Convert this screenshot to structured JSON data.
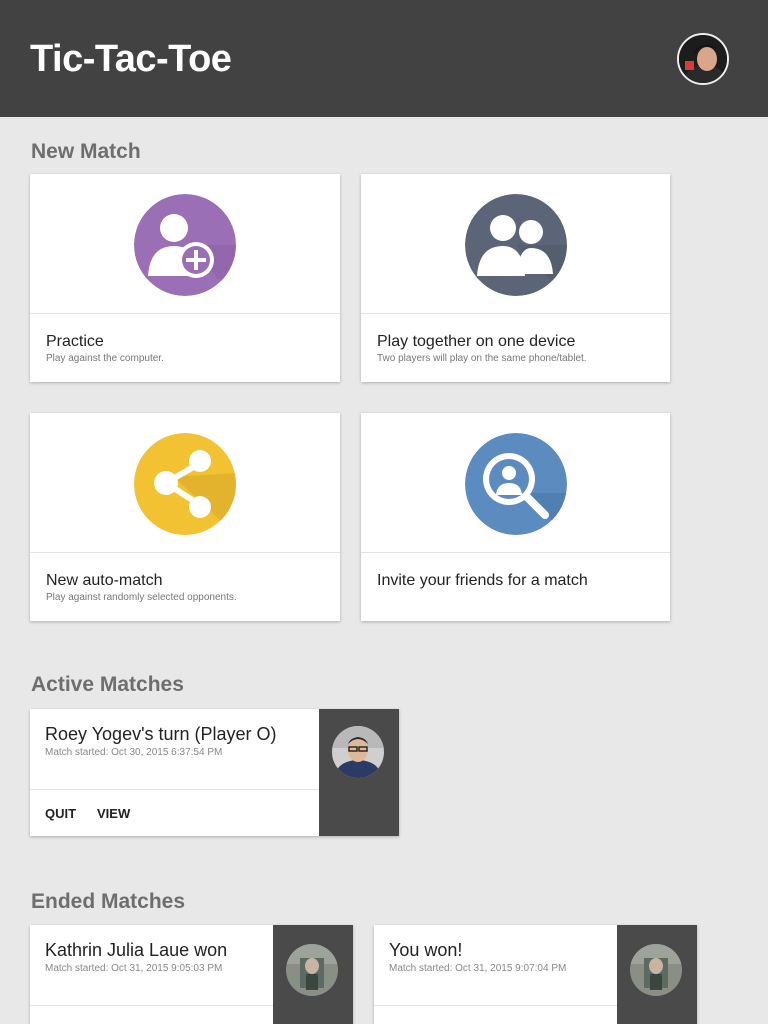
{
  "app": {
    "title": "Tic-Tac-Toe",
    "user_avatar_icon": "user-avatar-photo"
  },
  "sections": {
    "new_match": "New Match",
    "active_matches": "Active Matches",
    "ended_matches": "Ended Matches"
  },
  "new_match_options": [
    {
      "title": "Practice",
      "subtitle": "Play against the computer.",
      "icon": "add-user-icon",
      "color": "#9b6fb5"
    },
    {
      "title": "Play together on one device",
      "subtitle": "Two players will play on the same phone/tablet.",
      "icon": "two-users-icon",
      "color": "#5b6577"
    },
    {
      "title": "New auto-match",
      "subtitle": "Play against randomly selected opponents.",
      "icon": "share-icon",
      "color": "#f2c232"
    },
    {
      "title": "Invite your friends for a match",
      "subtitle": "",
      "icon": "search-user-icon",
      "color": "#5b8bbf"
    }
  ],
  "active_matches": [
    {
      "title": "Roey Yogev's turn (Player O)",
      "started": "Match started: Oct 30, 2015 6:37:54 PM",
      "actions": {
        "quit": "QUIT",
        "view": "VIEW"
      },
      "avatar_icon": "opponent-avatar-photo"
    }
  ],
  "ended_matches": [
    {
      "title": "Kathrin Julia Laue won",
      "started": "Match started: Oct 31, 2015 9:05:03 PM",
      "avatar_icon": "opponent-avatar-photo"
    },
    {
      "title": "You won!",
      "started": "Match started: Oct 31, 2015 9:07:04 PM",
      "avatar_icon": "opponent-avatar-photo"
    }
  ]
}
